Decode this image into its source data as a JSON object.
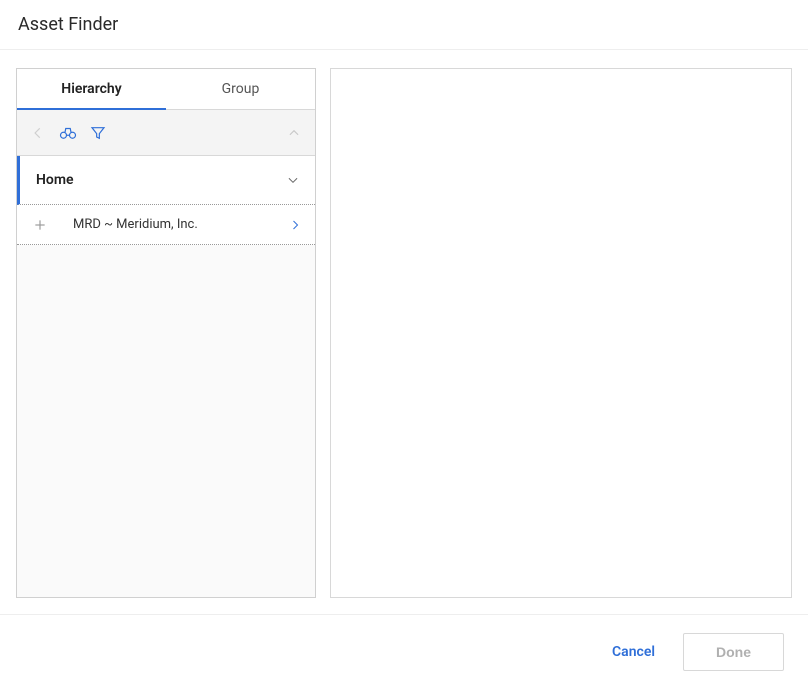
{
  "header": {
    "title": "Asset Finder"
  },
  "tabs": {
    "hierarchy": "Hierarchy",
    "group": "Group",
    "active": "hierarchy"
  },
  "tree": {
    "home_label": "Home",
    "items": [
      {
        "label": "MRD ~ Meridium, Inc."
      }
    ]
  },
  "footer": {
    "cancel_label": "Cancel",
    "done_label": "Done"
  }
}
